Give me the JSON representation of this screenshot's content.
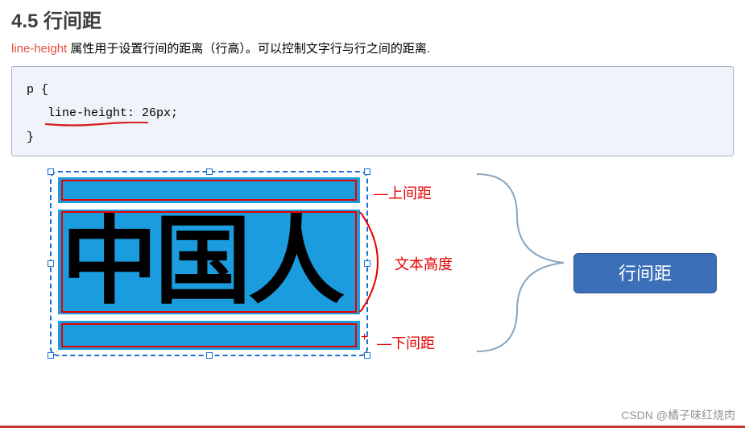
{
  "heading": "4.5 行间距",
  "intro": {
    "keyword": "line-height",
    "rest": " 属性用于设置行间的距离（行高）。可以控制文字行与行之间的距离."
  },
  "code": {
    "line1": "p {",
    "line2": "line-height: 26px;",
    "line3": "}"
  },
  "diagram": {
    "sample_text": "中国人",
    "label_top": "上间距",
    "label_mid": "文本高度",
    "label_bot": "下间距",
    "dash": "—",
    "cross": "+",
    "callout": "行间距"
  },
  "watermark": "CSDN @橘子味红烧肉"
}
